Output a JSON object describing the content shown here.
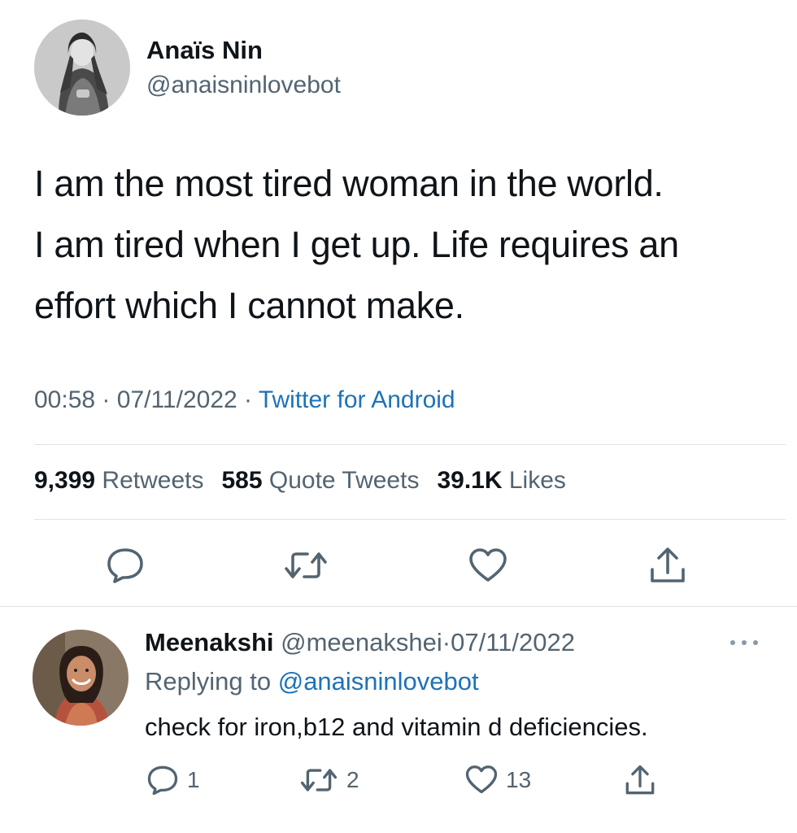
{
  "tweet": {
    "author_name": "Anaïs Nin",
    "author_handle": "@anaisninlovebot",
    "text_lines": [
      "I am the most tired woman in the world.",
      "I am tired when I get up. Life requires an",
      "effort which I cannot make."
    ],
    "time": "00:58",
    "date": "07/11/2022",
    "separator": "·",
    "source": "Twitter for Android",
    "stats": {
      "retweets_count": "9,399",
      "retweets_label": "Retweets",
      "quotes_count": "585",
      "quotes_label": "Quote Tweets",
      "likes_count": "39.1K",
      "likes_label": "Likes"
    },
    "actions": {
      "reply_icon": "reply-bubble-icon",
      "retweet_icon": "retweet-icon",
      "like_icon": "heart-icon",
      "share_icon": "share-upload-icon"
    }
  },
  "reply": {
    "author_name": "Meenakshi",
    "author_handle": "@meenakshei",
    "separator": "·",
    "date": "07/11/2022",
    "replying_prefix": "Replying to",
    "replying_to": "@anaisninlovebot",
    "text": "check for iron,b12 and vitamin d deficiencies.",
    "counts": {
      "replies": "1",
      "retweets": "2",
      "likes": "13"
    }
  },
  "colors": {
    "text_primary": "#0f1419",
    "text_secondary": "#536471",
    "link": "#1d72b8",
    "divider": "#dfe3e6"
  }
}
